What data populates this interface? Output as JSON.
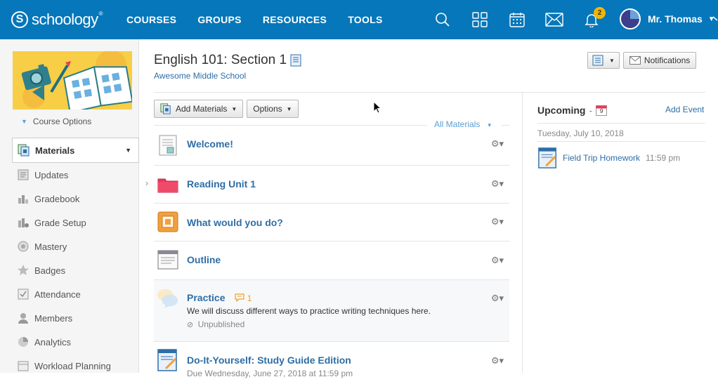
{
  "brand": {
    "logo_letter": "S",
    "name": "schoology",
    "tm": "®"
  },
  "nav": [
    {
      "label": "COURSES"
    },
    {
      "label": "GROUPS"
    },
    {
      "label": "RESOURCES"
    },
    {
      "label": "TOOLS"
    }
  ],
  "header": {
    "notifications_count": "2",
    "user_name": "Mr. Thomas"
  },
  "sidebar": {
    "course_options": "Course Options",
    "items": [
      {
        "label": "Materials"
      },
      {
        "label": "Updates"
      },
      {
        "label": "Gradebook"
      },
      {
        "label": "Grade Setup"
      },
      {
        "label": "Mastery"
      },
      {
        "label": "Badges"
      },
      {
        "label": "Attendance"
      },
      {
        "label": "Members"
      },
      {
        "label": "Analytics"
      },
      {
        "label": "Workload Planning"
      }
    ]
  },
  "course": {
    "title": "English 101: Section 1",
    "school": "Awesome Middle School",
    "notifications_label": "Notifications"
  },
  "toolbar": {
    "add_materials": "Add Materials",
    "options": "Options",
    "filter": "All Materials"
  },
  "materials": [
    {
      "title": "Welcome!",
      "type": "page"
    },
    {
      "title": "Reading Unit 1",
      "type": "folder"
    },
    {
      "title": "What would you do?",
      "type": "assignment"
    },
    {
      "title": "Outline",
      "type": "document"
    },
    {
      "title": "Practice",
      "type": "discussion",
      "comments": "1",
      "description": "We will discuss different ways to practice writing techniques here.",
      "status": "Unpublished"
    },
    {
      "title": "Do-It-Yourself: Study Guide Edition",
      "type": "assignment",
      "due": "Due Wednesday, June 27, 2018 at 11:59 pm"
    }
  ],
  "upcoming": {
    "title": "Upcoming",
    "calendar_day": "9",
    "add_event": "Add Event",
    "date": "Tuesday, July 10, 2018",
    "event_title": "Field Trip Homework",
    "event_time": "11:59 pm"
  },
  "colors": {
    "topbar": "#0677ba",
    "link": "#2e6ea6",
    "badge": "#f4b400",
    "folder": "#e8395a"
  }
}
